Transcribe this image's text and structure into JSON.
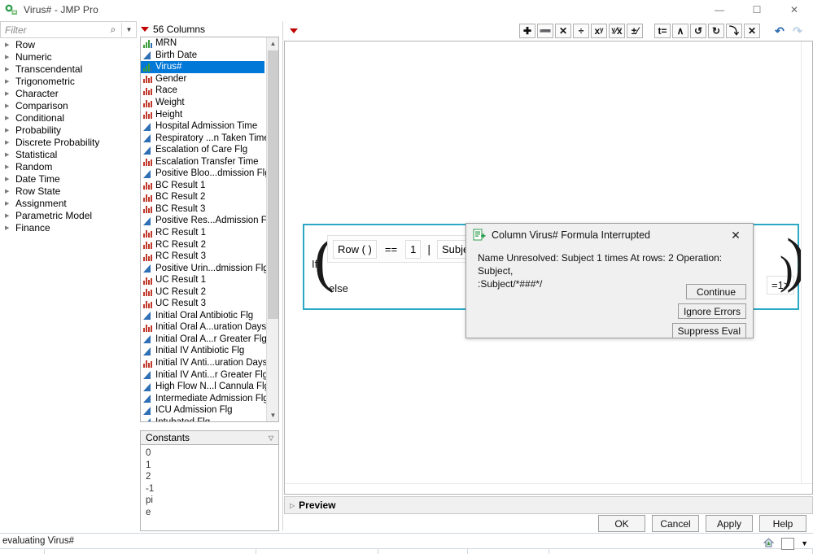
{
  "window": {
    "title": "Virus# - JMP Pro",
    "app_icon": "jmp-app-icon",
    "minimize": "—",
    "maximize": "☐",
    "close": "✕"
  },
  "filter": {
    "placeholder": "Filter",
    "value": "",
    "search_icon": "⌕",
    "dropdown_icon": "▼"
  },
  "function_tree": {
    "items": [
      {
        "label": "Row"
      },
      {
        "label": "Numeric"
      },
      {
        "label": "Transcendental"
      },
      {
        "label": "Trigonometric"
      },
      {
        "label": "Character"
      },
      {
        "label": "Comparison"
      },
      {
        "label": "Conditional"
      },
      {
        "label": "Probability"
      },
      {
        "label": "Discrete Probability"
      },
      {
        "label": "Statistical"
      },
      {
        "label": "Random"
      },
      {
        "label": "Date Time"
      },
      {
        "label": "Row State"
      },
      {
        "label": "Assignment"
      },
      {
        "label": "Parametric Model"
      },
      {
        "label": "Finance"
      }
    ],
    "expander_icon": "▶"
  },
  "columns_panel": {
    "header_label": "56 Columns",
    "header_menu_icon": "red-triangle-menu-icon",
    "scroll_up_icon": "ⱏ",
    "scroll_down_icon": "ⱐ24",
    "items": [
      {
        "label": "MRN",
        "type": "green"
      },
      {
        "label": "Birth Date",
        "type": "blue"
      },
      {
        "label": "Virus#",
        "type": "green",
        "selected": true
      },
      {
        "label": "Gender",
        "type": "red"
      },
      {
        "label": "Race",
        "type": "red"
      },
      {
        "label": "Weight",
        "type": "red"
      },
      {
        "label": "Height",
        "type": "red"
      },
      {
        "label": "Hospital Admission Time",
        "type": "blue"
      },
      {
        "label": "Respiratory ...n Taken Time",
        "type": "blue"
      },
      {
        "label": "Escalation of Care Flg",
        "type": "blue"
      },
      {
        "label": "Escalation Transfer Time",
        "type": "red"
      },
      {
        "label": "Positive Bloo...dmission Flg",
        "type": "blue"
      },
      {
        "label": "BC Result 1",
        "type": "red"
      },
      {
        "label": "BC Result 2",
        "type": "red"
      },
      {
        "label": "BC Result 3",
        "type": "red"
      },
      {
        "label": "Positive Res...Admission Flg",
        "type": "blue"
      },
      {
        "label": "RC Result 1",
        "type": "red"
      },
      {
        "label": "RC Result 2",
        "type": "red"
      },
      {
        "label": "RC Result 3",
        "type": "red"
      },
      {
        "label": "Positive Urin...dmission Flg",
        "type": "blue"
      },
      {
        "label": "UC Result 1",
        "type": "red"
      },
      {
        "label": "UC Result 2",
        "type": "red"
      },
      {
        "label": "UC Result 3",
        "type": "red"
      },
      {
        "label": "Initial Oral Antibiotic Flg",
        "type": "blue"
      },
      {
        "label": "Initial Oral A...uration Days",
        "type": "red"
      },
      {
        "label": "Initial Oral A...r Greater Flg",
        "type": "blue"
      },
      {
        "label": "Initial IV Antibiotic Flg",
        "type": "blue"
      },
      {
        "label": "Initial IV Anti...uration Days",
        "type": "red"
      },
      {
        "label": "Initial IV Anti...r Greater Flg",
        "type": "blue"
      },
      {
        "label": "High Flow N...l Cannula Flg",
        "type": "blue"
      },
      {
        "label": "Intermediate Admission Flg",
        "type": "blue"
      },
      {
        "label": "ICU Admission Flg",
        "type": "blue"
      },
      {
        "label": "Intubated Flg",
        "type": "blue"
      }
    ]
  },
  "constants_panel": {
    "header_label": "Constants",
    "chevron_icon": "ˇ",
    "items": [
      "0",
      "1",
      "2",
      "-1",
      "pi",
      "e"
    ]
  },
  "formula_toolbar": {
    "menu_icon": "red-triangle-menu-icon",
    "buttons": [
      {
        "name": "add-button",
        "glyph": "✚"
      },
      {
        "name": "subtract-button",
        "glyph": "➖"
      },
      {
        "name": "multiply-button",
        "glyph": "✕"
      },
      {
        "name": "divide-button",
        "glyph": "÷"
      },
      {
        "name": "exponent-button",
        "glyph": "xʸ"
      },
      {
        "name": "root-button",
        "glyph": "ʸ⁄x̅"
      },
      {
        "name": "plus-minus-button",
        "glyph": "±⁄"
      }
    ],
    "buttons2": [
      {
        "name": "transpose-button",
        "glyph": "t="
      },
      {
        "name": "move-up-button",
        "glyph": "∧"
      },
      {
        "name": "rotate-button",
        "glyph": "↺"
      },
      {
        "name": "swap-button",
        "glyph": "↻"
      },
      {
        "name": "insert-button",
        "glyph": "⤵"
      },
      {
        "name": "delete-button",
        "glyph": "✕"
      }
    ],
    "undo": {
      "name": "undo-button",
      "glyph": "↶"
    },
    "redo": {
      "name": "redo-button",
      "glyph": "↷"
    }
  },
  "formula": {
    "keyword_if": "If",
    "keyword_else": "else",
    "open_paren": "(",
    "close_paren": ")",
    "tokens": [
      {
        "text": "Row ( )"
      },
      {
        "text": "=="
      },
      {
        "text": "1"
      }
    ],
    "or_operator": "|",
    "condition2": "Subject ≠ Lag",
    "tail_token": "=1>"
  },
  "preview": {
    "label": "Preview",
    "expander_icon": "▷"
  },
  "action_buttons": [
    {
      "label": "OK",
      "name": "ok-button"
    },
    {
      "label": "Cancel",
      "name": "cancel-button"
    },
    {
      "label": "Apply",
      "name": "apply-button"
    },
    {
      "label": "Help",
      "name": "help-button"
    }
  ],
  "status_bar": {
    "message": "evaluating Virus#",
    "home_icon": "home-up-icon",
    "dropdown_icon": "▼"
  },
  "dialog": {
    "icon": "formula-column-icon",
    "title": "Column Virus# Formula Interrupted",
    "close_icon": "✕",
    "message_line1": "Name Unresolved: Subject 1 times At rows: 2 Operation: Subject,",
    "message_line2": ":Subject/*###*/",
    "buttons": [
      {
        "label": "Continue",
        "name": "continue-button"
      },
      {
        "label": "Ignore Errors",
        "name": "ignore-errors-button"
      },
      {
        "label": "Suppress Eval",
        "name": "suppress-eval-button"
      }
    ]
  },
  "colors": {
    "selection_blue": "#0078d7",
    "accent_teal": "#2aa8c4",
    "nominal_red": "#c0392b",
    "continuous_blue": "#2f6fb5",
    "continuous_green": "#3a9e3a",
    "menu_red": "#c00000"
  }
}
